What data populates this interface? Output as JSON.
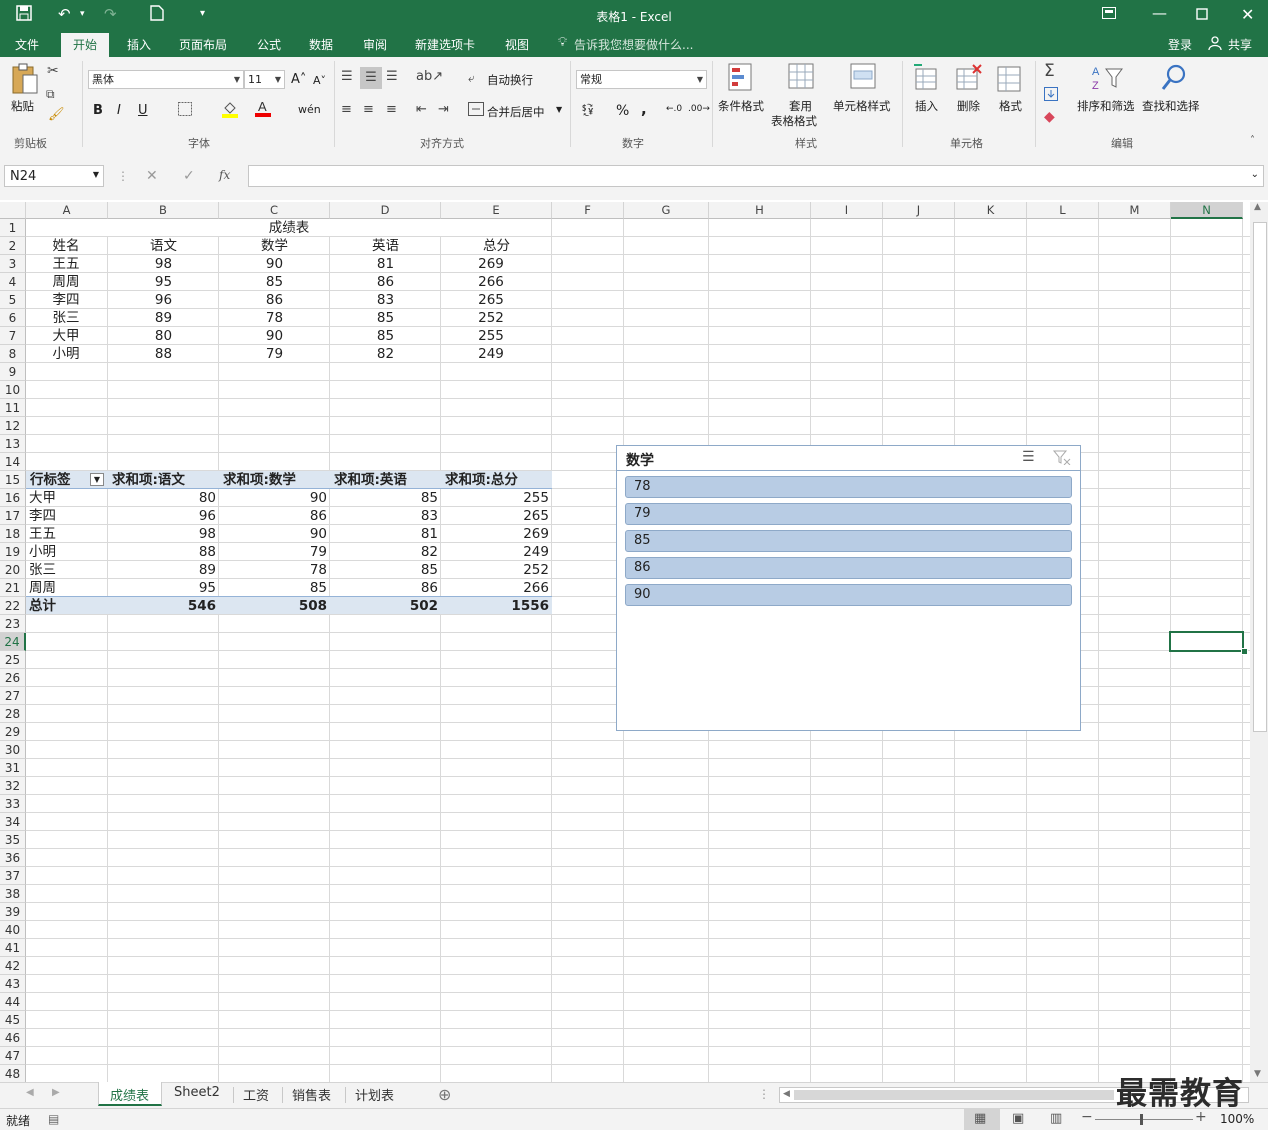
{
  "titlebar": {
    "title": "表格1 - Excel",
    "icons": [
      "save-icon",
      "undo-icon",
      "redo-icon",
      "new-doc-icon",
      "qat-customize-icon",
      "ribbon-display-icon",
      "minimize-icon",
      "maximize-icon",
      "close-icon"
    ]
  },
  "tabs": {
    "file": "文件",
    "home": "开始",
    "insert": "插入",
    "layout": "页面布局",
    "formulas": "公式",
    "data": "数据",
    "review": "审阅",
    "newtab": "新建选项卡",
    "view": "视图",
    "tellme": "告诉我您想要做什么...",
    "login": "登录",
    "share": "共享"
  },
  "ribbon": {
    "paste": "粘贴",
    "clipboard": "剪贴板",
    "font_name": "黑体",
    "font_size": "11",
    "font_group": "字体",
    "bold": "B",
    "italic": "I",
    "underline": "U",
    "wrap": "自动换行",
    "merge": "合并后居中",
    "align_group": "对齐方式",
    "number_format": "常规",
    "percent": "%",
    "comma": ",",
    "number_group": "数字",
    "cond_format": "条件格式",
    "table_format_1": "套用",
    "table_format_2": "表格格式",
    "cell_style": "单元格样式",
    "style_group": "样式",
    "insert": "插入",
    "delete": "删除",
    "format": "格式",
    "cells_group": "单元格",
    "sort_filter": "排序和筛选",
    "find_select": "查找和选择",
    "edit_group": "编辑"
  },
  "formula_bar": {
    "name_box": "N24",
    "fx": "fx",
    "formula": ""
  },
  "columns": [
    "A",
    "B",
    "C",
    "D",
    "E",
    "F",
    "G",
    "H",
    "I",
    "J",
    "K",
    "L",
    "M",
    "N"
  ],
  "rows": [
    "1",
    "2",
    "3",
    "4",
    "5",
    "6",
    "7",
    "8",
    "9",
    "10",
    "11",
    "12",
    "13",
    "14",
    "15",
    "16",
    "17",
    "18",
    "19",
    "20",
    "21",
    "22",
    "23",
    "24",
    "25",
    "26",
    "27",
    "28",
    "29",
    "30",
    "31",
    "32",
    "33",
    "34",
    "35",
    "36",
    "37",
    "38",
    "39",
    "40",
    "41",
    "42",
    "43",
    "44",
    "45",
    "46",
    "47",
    "48"
  ],
  "selected_cell": "N24",
  "table": {
    "title": "成绩表",
    "headers": [
      "姓名",
      "语文",
      "数学",
      "英语",
      "总分"
    ],
    "rows": [
      [
        "王五",
        "98",
        "90",
        "81",
        "269"
      ],
      [
        "周周",
        "95",
        "85",
        "86",
        "266"
      ],
      [
        "李四",
        "96",
        "86",
        "83",
        "265"
      ],
      [
        "张三",
        "89",
        "78",
        "85",
        "252"
      ],
      [
        "大甲",
        "80",
        "90",
        "85",
        "255"
      ],
      [
        "小明",
        "88",
        "79",
        "82",
        "249"
      ]
    ]
  },
  "pivot": {
    "headers": [
      "行标签",
      "求和项:语文",
      "求和项:数学",
      "求和项:英语",
      "求和项:总分"
    ],
    "rows": [
      [
        "大甲",
        "80",
        "90",
        "85",
        "255"
      ],
      [
        "李四",
        "96",
        "86",
        "83",
        "265"
      ],
      [
        "王五",
        "98",
        "90",
        "81",
        "269"
      ],
      [
        "小明",
        "88",
        "79",
        "82",
        "249"
      ],
      [
        "张三",
        "89",
        "78",
        "85",
        "252"
      ],
      [
        "周周",
        "95",
        "85",
        "86",
        "266"
      ]
    ],
    "total": [
      "总计",
      "546",
      "508",
      "502",
      "1556"
    ]
  },
  "slicer": {
    "title": "数学",
    "items": [
      "78",
      "79",
      "85",
      "86",
      "90"
    ]
  },
  "sheets": [
    "成绩表",
    "Sheet2",
    "工资",
    "销售表",
    "计划表"
  ],
  "active_sheet": "成绩表",
  "status": {
    "ready": "就绪",
    "zoom": "100%"
  },
  "watermark": "最需教育"
}
